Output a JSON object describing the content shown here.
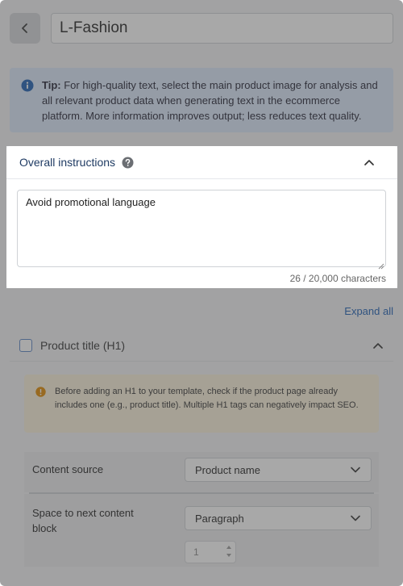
{
  "header": {
    "title_value": "L-Fashion"
  },
  "tip": {
    "label": "Tip:",
    "text": "For high-quality text, select the main product image for analysis and all relevant product data when generating text in the ecommerce platform. More information improves output; less reduces text quality."
  },
  "instructions": {
    "title": "Overall instructions",
    "value": "Avoid promotional language",
    "counter": "26 / 20,000 characters"
  },
  "expand_all": "Expand all",
  "section": {
    "title": "Product title (H1)",
    "warning": "Before adding an H1 to your template, check if the product page already includes one (e.g., product title). Multiple H1 tags can negatively impact SEO.",
    "content_source_label": "Content source",
    "content_source_value": "Product name",
    "space_label": "Space to next content block",
    "space_value": "Paragraph",
    "stepper_value": "1"
  },
  "colors": {
    "accent": "#1d5fb4",
    "info": "#1d5fb4",
    "warning": "#e08a00",
    "overlay": "#464646"
  },
  "icons": {
    "back": "chevron-left-icon",
    "info": "info-icon",
    "help": "help-icon",
    "collapse": "chevron-up-icon",
    "warning": "warning-icon",
    "dropdown": "chevron-down-icon"
  }
}
